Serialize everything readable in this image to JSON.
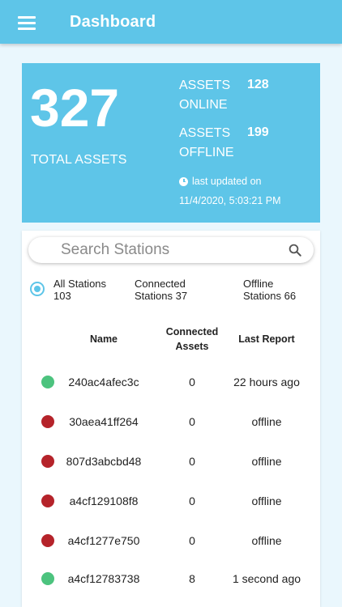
{
  "appbar": {
    "title": "Dashboard"
  },
  "summary": {
    "total_value": "327",
    "total_label": "TOTAL ASSETS",
    "online_label_1": "ASSETS",
    "online_label_2": "ONLINE",
    "online_value": "128",
    "offline_label_1": "ASSETS",
    "offline_label_2": "OFFLINE",
    "offline_value": "199",
    "updated_label": "last updated on",
    "updated_date": "11/4/2020, 5:03:21 PM"
  },
  "search": {
    "placeholder": "Search Stations"
  },
  "filters": {
    "all": {
      "line1": "All Stations",
      "line2": "103"
    },
    "connected": {
      "line1": "Connected",
      "line2": "Stations 37"
    },
    "offline": {
      "line1": "Offline",
      "line2": "Stations 66"
    }
  },
  "table": {
    "headers": {
      "name": "Name",
      "assets_1": "Connected",
      "assets_2": "Assets",
      "report": "Last Report"
    },
    "rows": [
      {
        "status": "online",
        "name": "240ac4afec3c",
        "assets": "0",
        "report": "22 hours ago"
      },
      {
        "status": "offline",
        "name": "30aea41ff264",
        "assets": "0",
        "report": "offline"
      },
      {
        "status": "offline",
        "name": "807d3abcbd48",
        "assets": "0",
        "report": "offline"
      },
      {
        "status": "offline",
        "name": "a4cf129108f8",
        "assets": "0",
        "report": "offline"
      },
      {
        "status": "offline",
        "name": "a4cf1277e750",
        "assets": "0",
        "report": "offline"
      },
      {
        "status": "online",
        "name": "a4cf12783738",
        "assets": "8",
        "report": "1 second ago"
      }
    ]
  },
  "colors": {
    "primary": "#5ec5e8",
    "online": "#4cc37e",
    "offline": "#b5232a"
  }
}
